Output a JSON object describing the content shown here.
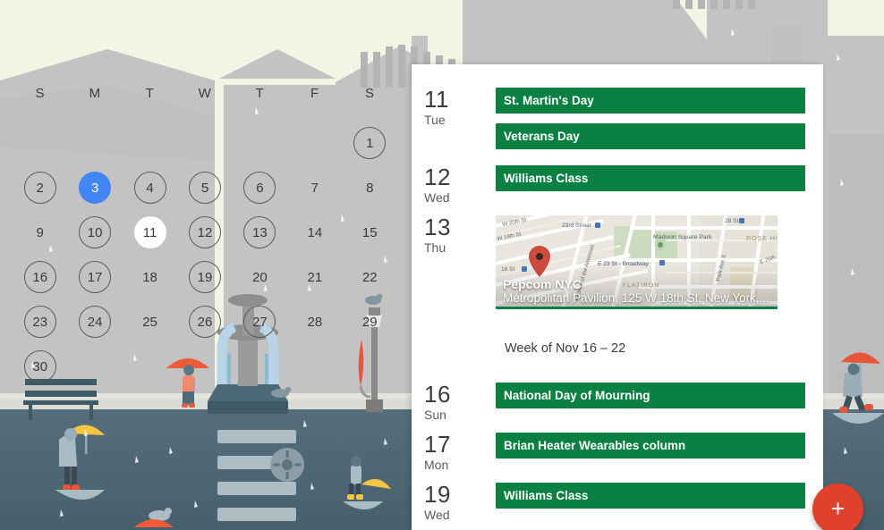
{
  "theme": {
    "sky": "#F0F5E4",
    "building_gray": "#C0C0C0",
    "pavement": "#D9D9D4",
    "water": "#4C6573",
    "accent_blue": "#4285F4",
    "event_green": "#0B8043",
    "fab_red": "#E0402C",
    "panel_white": "#FFFFFF"
  },
  "month_calendar": {
    "weekday_headers": [
      "S",
      "M",
      "T",
      "W",
      "T",
      "F",
      "S"
    ],
    "weeks": [
      [
        {
          "label": "",
          "style": "empty"
        },
        {
          "label": "",
          "style": "empty"
        },
        {
          "label": "",
          "style": "empty"
        },
        {
          "label": "",
          "style": "empty"
        },
        {
          "label": "",
          "style": "empty"
        },
        {
          "label": "",
          "style": "empty"
        },
        {
          "label": "1",
          "style": "ring"
        }
      ],
      [
        {
          "label": "2",
          "style": "ring"
        },
        {
          "label": "3",
          "style": "filled-blue"
        },
        {
          "label": "4",
          "style": "ring"
        },
        {
          "label": "5",
          "style": "ring"
        },
        {
          "label": "6",
          "style": "ring"
        },
        {
          "label": "7",
          "style": "plain"
        },
        {
          "label": "8",
          "style": "plain"
        }
      ],
      [
        {
          "label": "9",
          "style": "plain"
        },
        {
          "label": "10",
          "style": "ring"
        },
        {
          "label": "11",
          "style": "filled-white"
        },
        {
          "label": "12",
          "style": "ring"
        },
        {
          "label": "13",
          "style": "ring"
        },
        {
          "label": "14",
          "style": "plain"
        },
        {
          "label": "15",
          "style": "plain"
        }
      ],
      [
        {
          "label": "16",
          "style": "ring"
        },
        {
          "label": "17",
          "style": "ring"
        },
        {
          "label": "18",
          "style": "plain"
        },
        {
          "label": "19",
          "style": "ring"
        },
        {
          "label": "20",
          "style": "plain"
        },
        {
          "label": "21",
          "style": "plain"
        },
        {
          "label": "22",
          "style": "plain"
        }
      ],
      [
        {
          "label": "23",
          "style": "ring"
        },
        {
          "label": "24",
          "style": "ring"
        },
        {
          "label": "25",
          "style": "plain"
        },
        {
          "label": "26",
          "style": "ring"
        },
        {
          "label": "27",
          "style": "ring"
        },
        {
          "label": "28",
          "style": "plain"
        },
        {
          "label": "29",
          "style": "plain"
        }
      ],
      [
        {
          "label": "30",
          "style": "ring"
        },
        {
          "label": "",
          "style": "empty"
        },
        {
          "label": "",
          "style": "empty"
        },
        {
          "label": "",
          "style": "empty"
        },
        {
          "label": "",
          "style": "empty"
        },
        {
          "label": "",
          "style": "empty"
        },
        {
          "label": "",
          "style": "empty"
        }
      ]
    ]
  },
  "agenda": {
    "days": [
      {
        "date": "11",
        "weekday": "Tue",
        "events": [
          {
            "type": "event",
            "title": "St. Martin's Day"
          },
          {
            "type": "event",
            "title": "Veterans Day"
          }
        ]
      },
      {
        "date": "12",
        "weekday": "Wed",
        "events": [
          {
            "type": "event",
            "title": "Williams Class"
          }
        ]
      },
      {
        "date": "13",
        "weekday": "Thu",
        "events": [
          {
            "type": "map",
            "title": "Pepcom NYC",
            "address": "Metropolitan Pavilion, 125 W 18th St, New York,...",
            "map_labels": [
              "W 20th St",
              "W 19th St",
              "23rd Street",
              "18 St",
              "Avenue of the Americas",
              "E 23 St - Broadway",
              "Madison Square Park",
              "FLATIRON",
              "28 St",
              "Park Ave S",
              "ROSE HI",
              "E 26th"
            ]
          }
        ]
      }
    ],
    "week_divider": {
      "label": "Week of Nov 16 – 22"
    },
    "days_after_divider": [
      {
        "date": "16",
        "weekday": "Sun",
        "events": [
          {
            "type": "event",
            "title": "National Day of Mourning"
          }
        ]
      },
      {
        "date": "17",
        "weekday": "Mon",
        "events": [
          {
            "type": "event",
            "title": "Brian Heater Wearables column"
          }
        ]
      },
      {
        "date": "19",
        "weekday": "Wed",
        "events": [
          {
            "type": "event",
            "title": "Williams Class"
          }
        ]
      }
    ]
  },
  "fab": {
    "label": "+",
    "icon": "plus-icon"
  }
}
